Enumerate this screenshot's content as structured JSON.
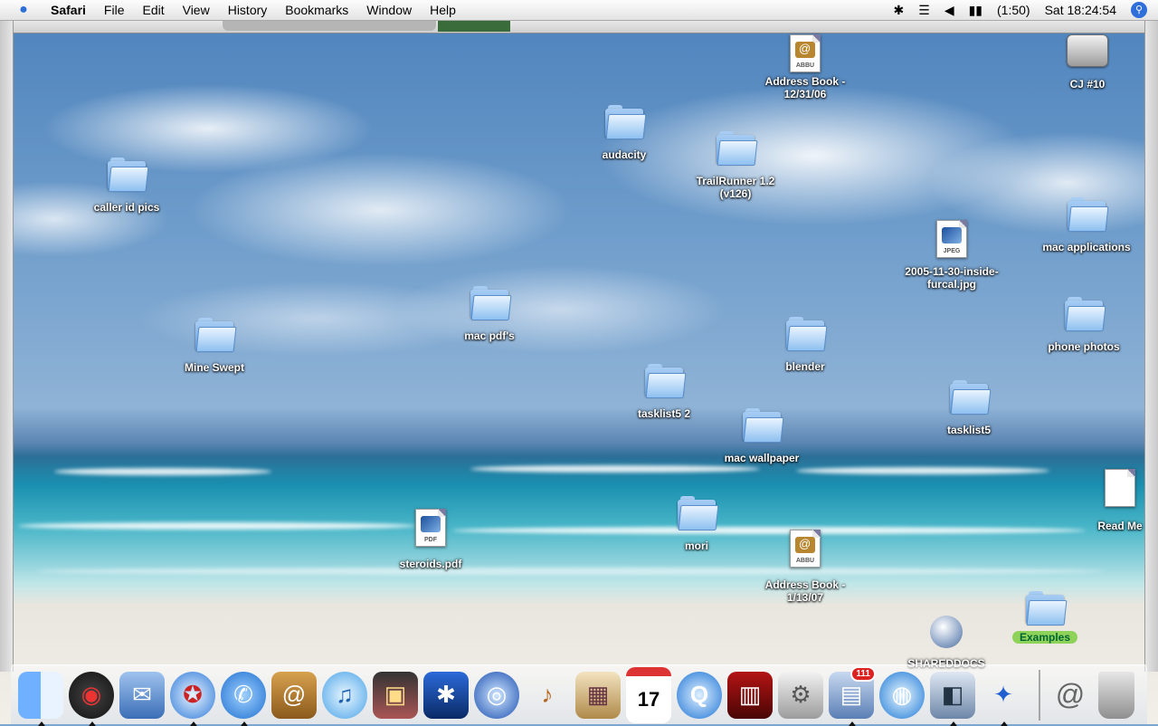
{
  "menubar": {
    "apple_icon": "apple-icon",
    "app_name": "Safari",
    "menus": [
      "File",
      "Edit",
      "View",
      "History",
      "Bookmarks",
      "Window",
      "Help"
    ],
    "status": {
      "bluetooth_icon": "bluetooth-icon",
      "wifi_icon": "wifi-icon",
      "volume_icon": "volume-icon",
      "battery_icon": "battery-icon",
      "battery_text": "(1:50)",
      "clock": "Sat 18:24:54",
      "spotlight_icon": "spotlight-icon"
    }
  },
  "desktop": {
    "icons": [
      {
        "label": "Address Book -\n12/31/06",
        "type": "addressbook-archive",
        "tag": "ABBU"
      },
      {
        "label": "CJ #10",
        "type": "hard-drive"
      },
      {
        "label": "audacity",
        "type": "folder"
      },
      {
        "label": "TrailRunner 1.2\n(v126)",
        "type": "folder"
      },
      {
        "label": "caller id pics",
        "type": "folder"
      },
      {
        "label": "mac applications",
        "type": "folder"
      },
      {
        "label": "2005-11-30-inside-\nfurcal.jpg",
        "type": "jpeg-file",
        "tag": "JPEG"
      },
      {
        "label": "mac pdf's",
        "type": "folder"
      },
      {
        "label": "phone photos",
        "type": "folder"
      },
      {
        "label": "Mine Swept",
        "type": "folder"
      },
      {
        "label": "blender",
        "type": "folder"
      },
      {
        "label": "tasklist5 2",
        "type": "folder"
      },
      {
        "label": "tasklist5",
        "type": "folder"
      },
      {
        "label": "mac wallpaper",
        "type": "folder"
      },
      {
        "label": "Read Me",
        "type": "document"
      },
      {
        "label": "mori",
        "type": "folder"
      },
      {
        "label": "steroids.pdf",
        "type": "pdf-file",
        "tag": "PDF"
      },
      {
        "label": "Address Book -\n1/13/07",
        "type": "addressbook-archive",
        "tag": "ABBU"
      },
      {
        "label": "Examples",
        "type": "folder"
      },
      {
        "label": "SHAREDDOCS",
        "type": "network-volume"
      }
    ]
  },
  "dock": {
    "items": [
      {
        "name": "finder-icon",
        "glyph": "☺",
        "running": true
      },
      {
        "name": "dashboard-icon",
        "glyph": "◉",
        "running": true
      },
      {
        "name": "mail-icon",
        "glyph": "✉",
        "running": false
      },
      {
        "name": "safari-icon",
        "glyph": "✪",
        "running": true
      },
      {
        "name": "ichat-icon",
        "glyph": "✆",
        "running": true
      },
      {
        "name": "address-book-icon",
        "glyph": "@",
        "running": false
      },
      {
        "name": "itunes-icon",
        "glyph": "♫",
        "running": false
      },
      {
        "name": "iphoto-icon",
        "glyph": "▣",
        "running": false
      },
      {
        "name": "imovie-icon",
        "glyph": "✱",
        "running": false
      },
      {
        "name": "idvd-icon",
        "glyph": "◎",
        "running": false
      },
      {
        "name": "garageband-icon",
        "glyph": "♪",
        "running": false
      },
      {
        "name": "iweb-icon",
        "glyph": "▦",
        "running": false
      },
      {
        "name": "ical-icon",
        "glyph": "17",
        "running": false,
        "label_top": "JUL"
      },
      {
        "name": "quicktime-icon",
        "glyph": "Q",
        "running": false
      },
      {
        "name": "front-row-icon",
        "glyph": "▥",
        "running": false
      },
      {
        "name": "system-preferences-icon",
        "glyph": "",
        "running": false
      },
      {
        "name": "dock-app-badged-icon",
        "glyph": "▤",
        "running": true,
        "badge": "111"
      },
      {
        "name": "network-globe-icon",
        "glyph": "◍",
        "running": false
      },
      {
        "name": "preview-icon",
        "glyph": "◧",
        "running": true
      },
      {
        "name": "bluetooth-file-exchange-icon",
        "glyph": "✦",
        "running": true
      }
    ],
    "right_items": [
      {
        "name": "mail-at-stack-icon",
        "glyph": "@"
      },
      {
        "name": "trash-icon",
        "glyph": "🗑"
      }
    ]
  }
}
